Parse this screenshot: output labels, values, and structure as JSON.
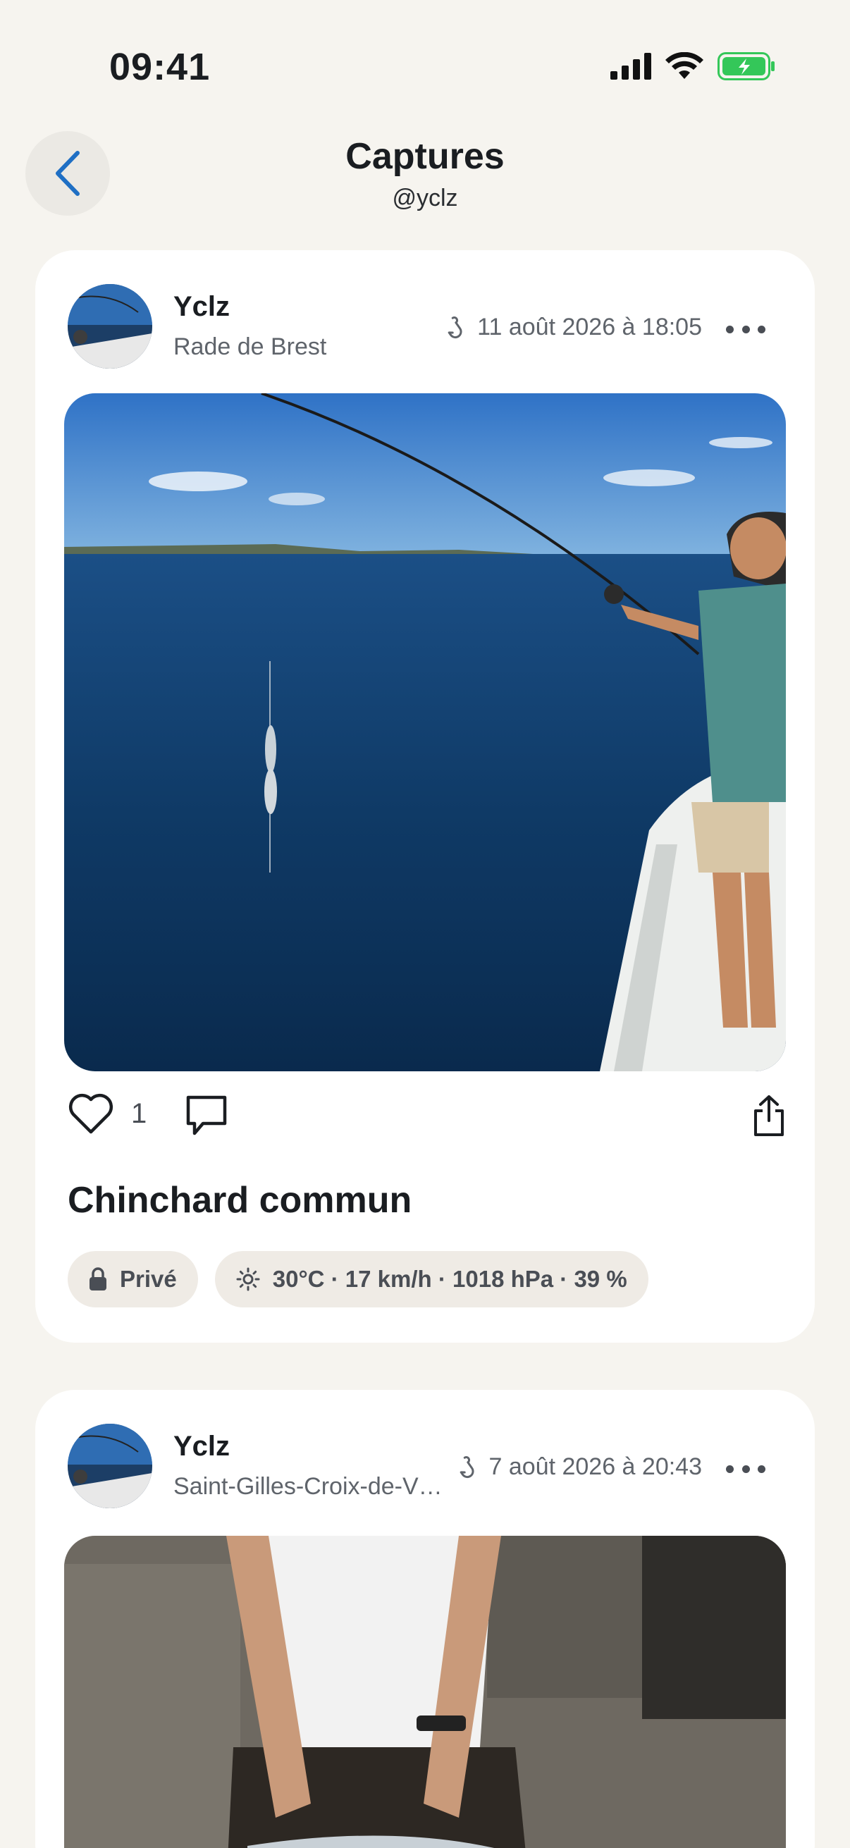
{
  "status": {
    "time": "09:41"
  },
  "header": {
    "title": "Captures",
    "subtitle": "@yclz"
  },
  "posts": [
    {
      "author": "Yclz",
      "location": "Rade de Brest",
      "date": "11 août 2026 à 18:05",
      "likes": "1",
      "species": "Chinchard commun",
      "privacy": "Privé",
      "weather": "30°C · 17 km/h · 1018 hPa · 39 %"
    },
    {
      "author": "Yclz",
      "location": "Saint-Gilles-Croix-de-V…",
      "date": "7 août 2026 à 20:43"
    }
  ],
  "colors": {
    "background": "#f6f4ef",
    "card": "#ffffff",
    "accent": "#1f6fc4",
    "battery": "#34c759",
    "chip": "#efebe5"
  },
  "icons": [
    "signal-icon",
    "wifi-icon",
    "battery-icon",
    "chevron-left-icon",
    "hook-icon",
    "more-icon",
    "heart-icon",
    "comment-icon",
    "share-icon",
    "lock-icon",
    "sun-icon"
  ]
}
